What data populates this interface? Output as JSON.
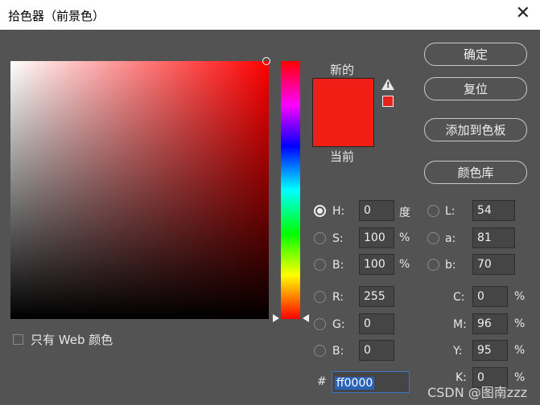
{
  "window": {
    "title": "拾色器（前景色）"
  },
  "buttons": {
    "ok": "确定",
    "reset": "复位",
    "add_to_swatches": "添加到色板",
    "color_libraries": "颜色库"
  },
  "swatch": {
    "new_label": "新的",
    "current_label": "当前",
    "new_color": "#f01e14",
    "current_color": "#f01e14",
    "gamut_color": "#e3241c"
  },
  "hsb": {
    "h": {
      "label": "H:",
      "value": "0",
      "unit": "度"
    },
    "s": {
      "label": "S:",
      "value": "100",
      "unit": "%"
    },
    "b": {
      "label": "B:",
      "value": "100",
      "unit": "%"
    }
  },
  "rgb": {
    "r": {
      "label": "R:",
      "value": "255"
    },
    "g": {
      "label": "G:",
      "value": "0"
    },
    "b": {
      "label": "B:",
      "value": "0"
    }
  },
  "lab": {
    "l": {
      "label": "L:",
      "value": "54"
    },
    "a": {
      "label": "a:",
      "value": "81"
    },
    "b": {
      "label": "b:",
      "value": "70"
    }
  },
  "cmyk": {
    "c": {
      "label": "C:",
      "value": "0",
      "unit": "%"
    },
    "m": {
      "label": "M:",
      "value": "96",
      "unit": "%"
    },
    "y": {
      "label": "Y:",
      "value": "95",
      "unit": "%"
    },
    "k": {
      "label": "K:",
      "value": "0",
      "unit": "%"
    }
  },
  "hex": {
    "label": "#",
    "value": "ff0000"
  },
  "web_only": {
    "label": "只有 Web 颜色",
    "checked": false
  },
  "watermark": "CSDN @图南zzz",
  "selected_mode": "H",
  "hue_color": "#ff0000"
}
